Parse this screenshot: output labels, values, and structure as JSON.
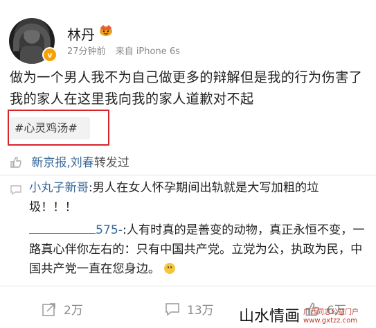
{
  "post": {
    "author": "林丹",
    "time": "27分钟前",
    "source": "来自 iPhone 6s",
    "vip_badge": "v",
    "text": "做为一个男人我不为自己做更多的辩解但是我的行为伤害了我的家人在这里我向我的家人道歉对不起",
    "hashtag": "#心灵鸡汤#",
    "accent_color": "#3a6a9a",
    "highlight_color": "#d8232a"
  },
  "likes": {
    "names": "新京报,刘春",
    "suffix": "转发过"
  },
  "comments": [
    {
      "user": "小丸子新哥",
      "text": ":男人在女人怀孕期间出轨就是大写加粗的垃圾！！！"
    },
    {
      "user": "575-",
      "text": ":人有时真的是善变的动物，真正永恒不变，一路真心伴你左右的：只有中国共产党。立党为公，执政为民，中国共产党一直在您身边。"
    }
  ],
  "stats": {
    "reposts": "2万",
    "comments": "13万",
    "likes": "6万"
  },
  "watermark": {
    "left": "山水情画",
    "right_title": "广西同志公益门户",
    "right_url": "www.gxtzz.com"
  }
}
